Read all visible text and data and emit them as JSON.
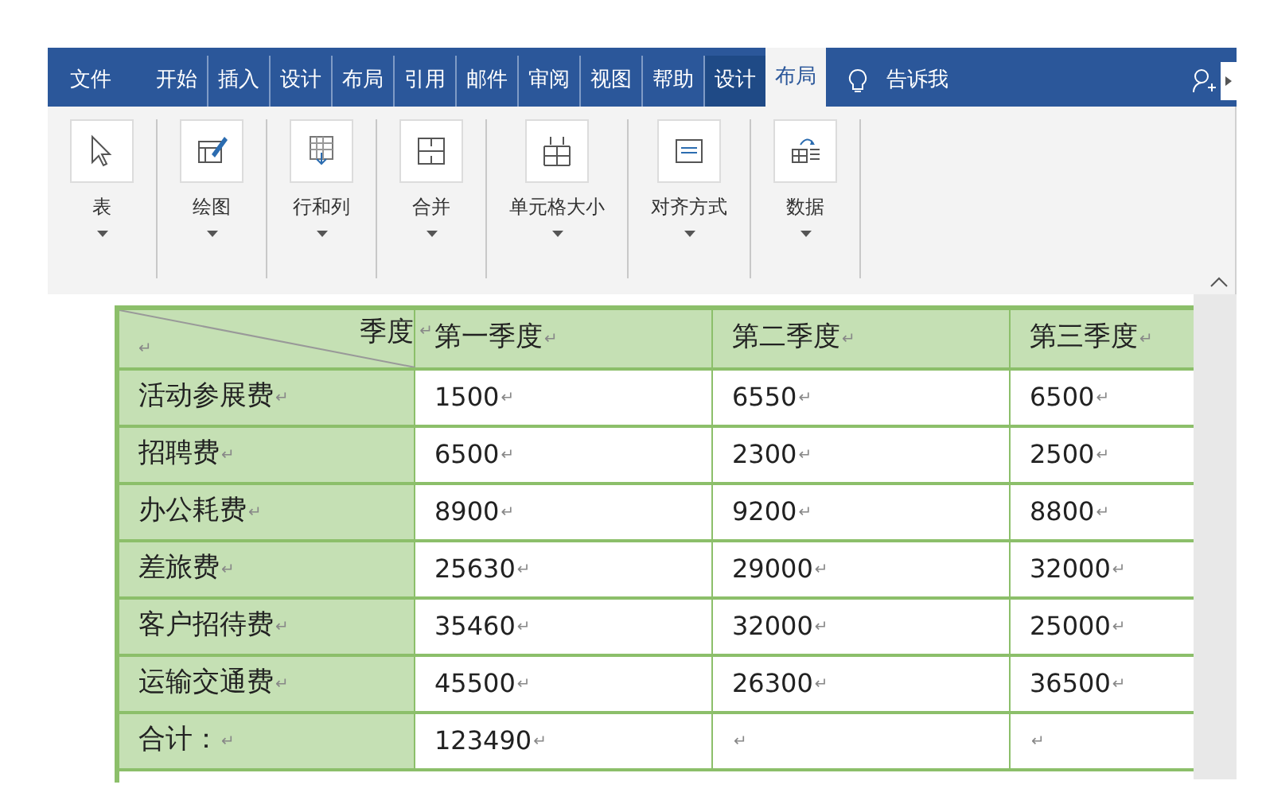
{
  "tabs": [
    {
      "label": "文件",
      "selected": false,
      "kind": "file"
    },
    {
      "label": "开始",
      "selected": false,
      "kind": "tab"
    },
    {
      "label": "插入",
      "selected": false,
      "kind": "tab"
    },
    {
      "label": "设计",
      "selected": false,
      "kind": "tab"
    },
    {
      "label": "布局",
      "selected": false,
      "kind": "tab"
    },
    {
      "label": "引用",
      "selected": false,
      "kind": "tab"
    },
    {
      "label": "邮件",
      "selected": false,
      "kind": "tab"
    },
    {
      "label": "审阅",
      "selected": false,
      "kind": "tab"
    },
    {
      "label": "视图",
      "selected": false,
      "kind": "tab"
    },
    {
      "label": "帮助",
      "selected": false,
      "kind": "tab"
    },
    {
      "label": "设计",
      "selected": false,
      "kind": "context"
    },
    {
      "label": "布局",
      "selected": true,
      "kind": "context"
    }
  ],
  "tell_me": "告诉我",
  "ribbon_groups": [
    {
      "label": "表",
      "kind": "cursor"
    },
    {
      "label": "绘图",
      "kind": "draw"
    },
    {
      "label": "行和列",
      "kind": "rows"
    },
    {
      "label": "合并",
      "kind": "merge"
    },
    {
      "label": "单元格大小",
      "kind": "size"
    },
    {
      "label": "对齐方式",
      "kind": "align"
    },
    {
      "label": "数据",
      "kind": "data"
    }
  ],
  "table": {
    "header": {
      "corner_label": "季度",
      "corner_mark": "↵",
      "corner_bottom_mark": "↵",
      "columns": [
        {
          "text": "第一季度",
          "mark": "↵"
        },
        {
          "text": "第二季度",
          "mark": "↵"
        },
        {
          "text": "第三季度",
          "mark": "↵"
        }
      ]
    },
    "rows": [
      {
        "label": "活动参展费",
        "mark": "↵",
        "cells": [
          {
            "text": "1500",
            "mark": "↵"
          },
          {
            "text": "6550",
            "mark": "↵"
          },
          {
            "text": "6500",
            "mark": "↵"
          }
        ]
      },
      {
        "label": "招聘费",
        "mark": "↵",
        "cells": [
          {
            "text": "6500",
            "mark": "↵"
          },
          {
            "text": "2300",
            "mark": "↵"
          },
          {
            "text": "2500",
            "mark": "↵"
          }
        ]
      },
      {
        "label": "办公耗费",
        "mark": "↵",
        "cells": [
          {
            "text": "8900",
            "mark": "↵"
          },
          {
            "text": "9200",
            "mark": "↵"
          },
          {
            "text": "8800",
            "mark": "↵"
          }
        ]
      },
      {
        "label": "差旅费",
        "mark": "↵",
        "cells": [
          {
            "text": "25630",
            "mark": "↵"
          },
          {
            "text": "29000",
            "mark": "↵"
          },
          {
            "text": "32000",
            "mark": "↵"
          }
        ]
      },
      {
        "label": "客户招待费",
        "mark": "↵",
        "cells": [
          {
            "text": "35460",
            "mark": "↵"
          },
          {
            "text": "32000",
            "mark": "↵"
          },
          {
            "text": "25000",
            "mark": "↵"
          }
        ]
      },
      {
        "label": "运输交通费",
        "mark": "↵",
        "cells": [
          {
            "text": "45500",
            "mark": "↵"
          },
          {
            "text": "26300",
            "mark": "↵"
          },
          {
            "text": "36500",
            "mark": "↵"
          }
        ]
      },
      {
        "label": "合计：",
        "mark": "↵",
        "cells": [
          {
            "text": "123490",
            "mark": "↵"
          },
          {
            "mark": "↵"
          },
          {
            "mark": "↵"
          }
        ]
      }
    ]
  }
}
